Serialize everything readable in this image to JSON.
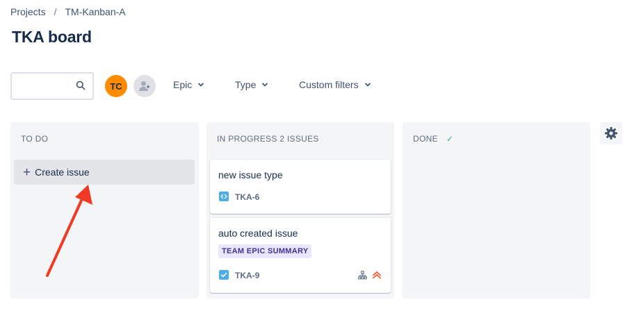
{
  "breadcrumb": {
    "items": [
      "Projects",
      "TM-Kanban-A"
    ],
    "separator": "/"
  },
  "page": {
    "title": "TKA board"
  },
  "toolbar": {
    "search": {
      "value": "",
      "placeholder": ""
    },
    "avatar_initials": "TC",
    "filters": [
      {
        "label": "Epic"
      },
      {
        "label": "Type"
      },
      {
        "label": "Custom filters"
      }
    ]
  },
  "board": {
    "columns": [
      {
        "title": "TO DO",
        "create_label": "Create issue"
      },
      {
        "title": "IN PROGRESS 2 ISSUES",
        "cards": [
          {
            "summary": "new issue type",
            "key": "TKA-6",
            "type_icon": "code-icon"
          },
          {
            "summary": "auto created issue",
            "epic": "TEAM EPIC SUMMARY",
            "key": "TKA-9",
            "type_icon": "task-checkbox-icon",
            "priority": "highest"
          }
        ]
      },
      {
        "title": "DONE",
        "done_mark": "✓"
      }
    ]
  },
  "colors": {
    "accent_avatar": "#ff8b00",
    "annotation_arrow": "#f03a23",
    "epic_bg": "#eae6ff",
    "epic_text": "#403294",
    "priority": "#ff5630",
    "done_check": "#36b37e"
  }
}
